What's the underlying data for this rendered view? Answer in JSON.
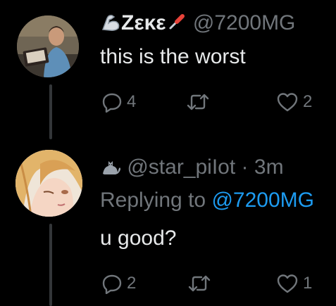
{
  "tweets": [
    {
      "display_name": "Zεκε",
      "handle": "@7200MG",
      "text": "this is the worst",
      "icons": [
        "flexed-biceps-icon",
        "screwdriver-icon"
      ],
      "counts": {
        "replies": "4",
        "likes": "2"
      }
    },
    {
      "handle": "@star_piIot",
      "separator": "·",
      "timestamp": "3m",
      "replying_to_prefix": "Replying to",
      "replying_to_handle": "@7200MG",
      "text": "u good?",
      "icons": [
        "black-cat-icon"
      ],
      "counts": {
        "replies": "2",
        "likes": "1"
      }
    }
  ],
  "colors": {
    "background": "#000000",
    "text": "#e7e9ea",
    "muted": "#71767b",
    "link": "#1d9bf0",
    "thread_line": "#333639"
  }
}
